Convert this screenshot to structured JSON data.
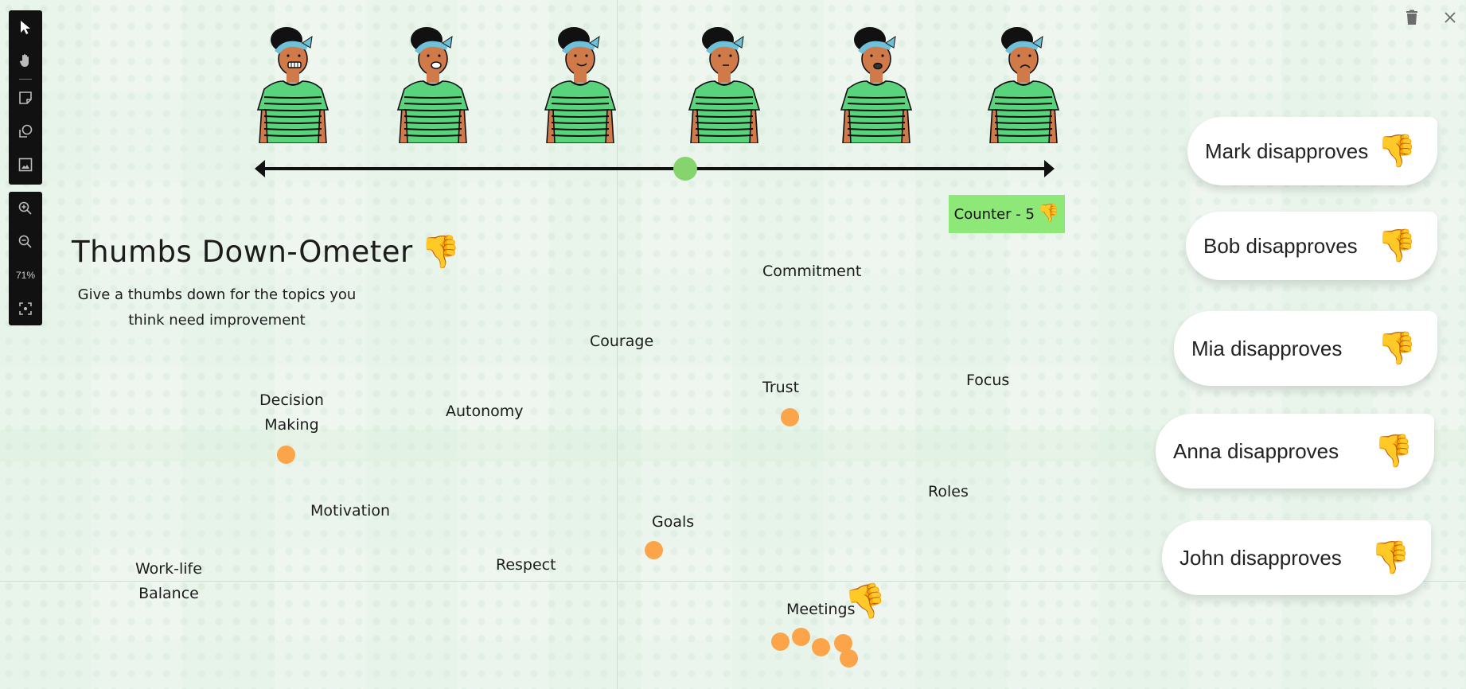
{
  "toolbar": {
    "tools": [
      {
        "name": "select",
        "icon": "cursor-icon"
      },
      {
        "name": "pan",
        "icon": "hand-icon"
      },
      {
        "name": "sticky-note",
        "icon": "sticky-note-icon"
      },
      {
        "name": "shapes",
        "icon": "shapes-icon"
      },
      {
        "name": "image",
        "icon": "image-icon"
      }
    ],
    "zoom_in": "zoom-in-icon",
    "zoom_out": "zoom-out-icon",
    "zoom_level": "71%",
    "fit": "fit-screen-icon"
  },
  "window_actions": {
    "delete": "trash-icon",
    "close": "close-icon"
  },
  "scale": {
    "faces": [
      "grinning",
      "surprised",
      "content",
      "uneasy",
      "worried",
      "sad"
    ],
    "slider_position": 0.54,
    "knob_color": "#86d46e"
  },
  "counter": {
    "label": "Counter - 5",
    "emoji": "👎",
    "color": "#8de878"
  },
  "title": {
    "text": "Thumbs Down-Ometer",
    "emoji": "👎"
  },
  "subtitle": "Give a thumbs down for the topics you think need improvement",
  "topics": [
    {
      "label": "Commitment",
      "votes": 0
    },
    {
      "label": "Courage",
      "votes": 0
    },
    {
      "label": "Trust",
      "votes": 1
    },
    {
      "label": "Focus",
      "votes": 0
    },
    {
      "label": "Decision\nMaking",
      "votes": 1
    },
    {
      "label": "Autonomy",
      "votes": 0
    },
    {
      "label": "Roles",
      "votes": 0
    },
    {
      "label": "Motivation",
      "votes": 0
    },
    {
      "label": "Goals",
      "votes": 1
    },
    {
      "label": "Work-life\nBalance",
      "votes": 0
    },
    {
      "label": "Respect",
      "votes": 0
    },
    {
      "label": "Meetings",
      "votes": 5
    }
  ],
  "meetings_emoji": "👎",
  "disapprovals": [
    {
      "label": "Mark disapproves",
      "emoji": "👎"
    },
    {
      "label": "Bob disapproves",
      "emoji": "👎"
    },
    {
      "label": "Mia disapproves",
      "emoji": "👎"
    },
    {
      "label": "Anna disapproves",
      "emoji": "👎"
    },
    {
      "label": "John disapproves",
      "emoji": "👎"
    }
  ],
  "colors": {
    "vote_dot": "#fba449",
    "background": "#eef6ef"
  }
}
